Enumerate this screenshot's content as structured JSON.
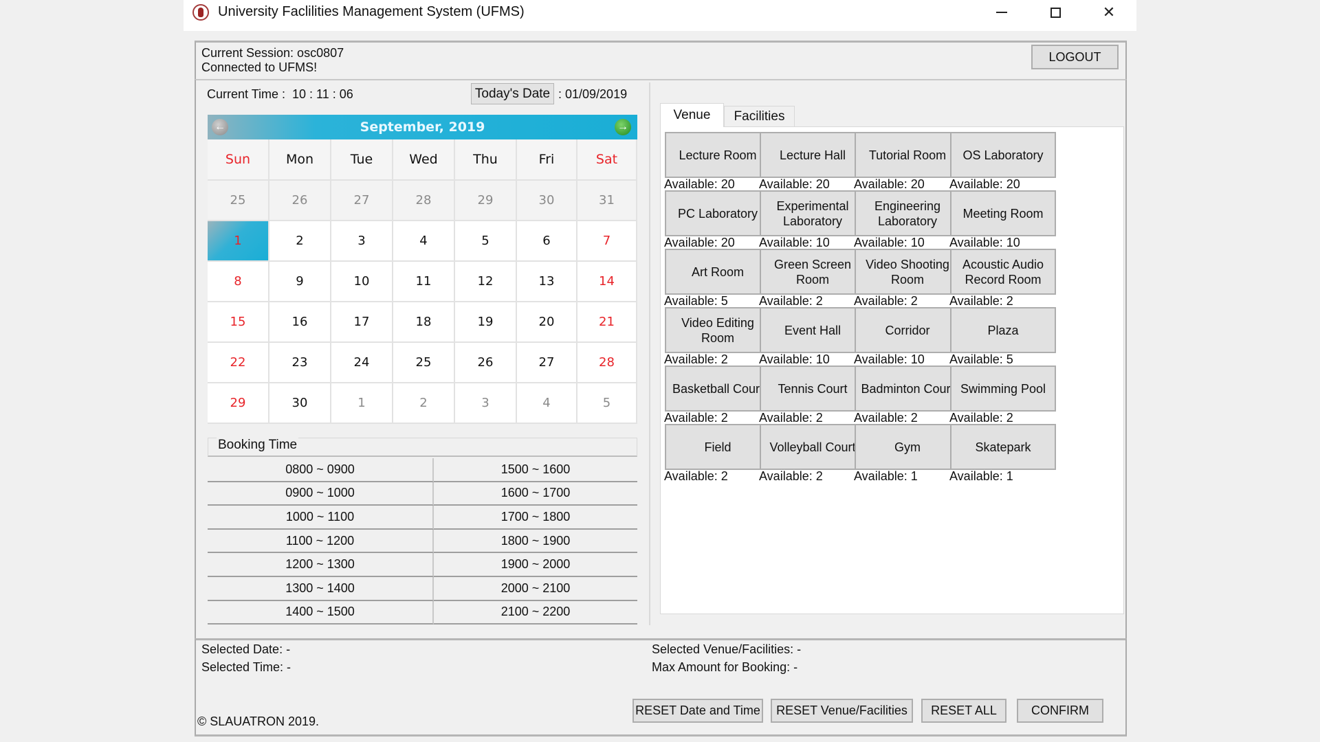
{
  "window": {
    "title": "University Faclilities Management System (UFMS)",
    "controls": {
      "minimize": "minimize",
      "maximize": "maximize",
      "close": "close"
    }
  },
  "session": {
    "line1": "Current Session: osc0807",
    "line2": "Connected to UFMS!",
    "logout_label": "LOGOUT"
  },
  "clock": {
    "time_label": "Current Time   :",
    "time_value": "10 : 11 : 06",
    "today_button": "Today's Date",
    "today_value": ": 01/09/2019"
  },
  "calendar": {
    "title": "September,   2019",
    "prev_icon": "←",
    "next_icon": "→",
    "day_names": [
      "Sun",
      "Mon",
      "Tue",
      "Wed",
      "Thu",
      "Fri",
      "Sat"
    ],
    "selected_day": 1,
    "weeks": [
      [
        {
          "d": "25",
          "other": true
        },
        {
          "d": "26",
          "other": true
        },
        {
          "d": "27",
          "other": true
        },
        {
          "d": "28",
          "other": true
        },
        {
          "d": "29",
          "other": true
        },
        {
          "d": "30",
          "other": true
        },
        {
          "d": "31",
          "other": true
        }
      ],
      [
        {
          "d": "1"
        },
        {
          "d": "2"
        },
        {
          "d": "3"
        },
        {
          "d": "4"
        },
        {
          "d": "5"
        },
        {
          "d": "6"
        },
        {
          "d": "7"
        }
      ],
      [
        {
          "d": "8"
        },
        {
          "d": "9"
        },
        {
          "d": "10"
        },
        {
          "d": "11"
        },
        {
          "d": "12"
        },
        {
          "d": "13"
        },
        {
          "d": "14"
        }
      ],
      [
        {
          "d": "15"
        },
        {
          "d": "16"
        },
        {
          "d": "17"
        },
        {
          "d": "18"
        },
        {
          "d": "19"
        },
        {
          "d": "20"
        },
        {
          "d": "21"
        }
      ],
      [
        {
          "d": "22"
        },
        {
          "d": "23"
        },
        {
          "d": "24"
        },
        {
          "d": "25"
        },
        {
          "d": "26"
        },
        {
          "d": "27"
        },
        {
          "d": "28"
        }
      ],
      [
        {
          "d": "29"
        },
        {
          "d": "30"
        },
        {
          "d": "1",
          "other": true
        },
        {
          "d": "2",
          "other": true
        },
        {
          "d": "3",
          "other": true
        },
        {
          "d": "4",
          "other": true
        },
        {
          "d": "5",
          "other": true
        }
      ]
    ]
  },
  "booking": {
    "title": "Booking Time",
    "left_slots": [
      "0800 ~ 0900",
      "0900 ~ 1000",
      "1000 ~ 1100",
      "1100 ~ 1200",
      "1200 ~ 1300",
      "1300 ~ 1400",
      "1400 ~ 1500"
    ],
    "right_slots": [
      "1500 ~ 1600",
      "1600 ~ 1700",
      "1700 ~ 1800",
      "1800 ~ 1900",
      "1900 ~ 2000",
      "2000 ~ 2100",
      "2100 ~ 2200"
    ]
  },
  "tabs": [
    {
      "label": "Venue",
      "active": true
    },
    {
      "label": "Facilities",
      "active": false
    }
  ],
  "venues": [
    {
      "name": "Lecture Room",
      "available": "Available: 20"
    },
    {
      "name": "Lecture Hall",
      "available": "Available: 20"
    },
    {
      "name": "Tutorial Room",
      "available": "Available:  20"
    },
    {
      "name": "OS Laboratory",
      "available": "Available: 20"
    },
    {
      "name": "PC Laboratory",
      "available": "Available: 20"
    },
    {
      "name": "Experimental\nLaboratory",
      "available": "Available: 10"
    },
    {
      "name": "Engineering\nLaboratory",
      "available": "Available: 10"
    },
    {
      "name": "Meeting Room",
      "available": "Available: 10"
    },
    {
      "name": "Art Room",
      "available": "Available: 5"
    },
    {
      "name": "Green Screen\nRoom",
      "available": "Available: 2"
    },
    {
      "name": "Video Shooting\nRoom",
      "available": "Available: 2"
    },
    {
      "name": "Acoustic Audio\nRecord Room",
      "available": "Available: 2"
    },
    {
      "name": "Video Editing\nRoom",
      "available": "Available: 2"
    },
    {
      "name": "Event Hall",
      "available": "Available: 10"
    },
    {
      "name": "Corridor",
      "available": "Available: 10"
    },
    {
      "name": "Plaza",
      "available": "Available: 5"
    },
    {
      "name": "Basketball Court",
      "available": "Available: 2"
    },
    {
      "name": "Tennis Court",
      "available": "Available: 2"
    },
    {
      "name": "Badminton Court",
      "available": "Available: 2"
    },
    {
      "name": "Swimming Pool",
      "available": "Available: 2"
    },
    {
      "name": "Field",
      "available": "Available: 2"
    },
    {
      "name": "Volleyball Court",
      "available": "Available: 2"
    },
    {
      "name": "Gym",
      "available": "Available: 1"
    },
    {
      "name": "Skatepark",
      "available": "Available: 1"
    }
  ],
  "status": {
    "selected_date": "Selected Date: -",
    "selected_time": "Selected Time: -",
    "selected_venue": "Selected Venue/Facilities: -",
    "max_amount": "Max Amount for Booking: -",
    "copyright": "© SLAUATRON 2019."
  },
  "actions": {
    "reset_date_time": "RESET Date and Time",
    "reset_venue": "RESET Venue/Facilities",
    "reset_all": "RESET ALL",
    "confirm": "CONFIRM"
  },
  "colors": {
    "calendar_accent": "#1aaed6",
    "weekend_red": "#e8242a",
    "next_green": "#1f8a1f"
  }
}
